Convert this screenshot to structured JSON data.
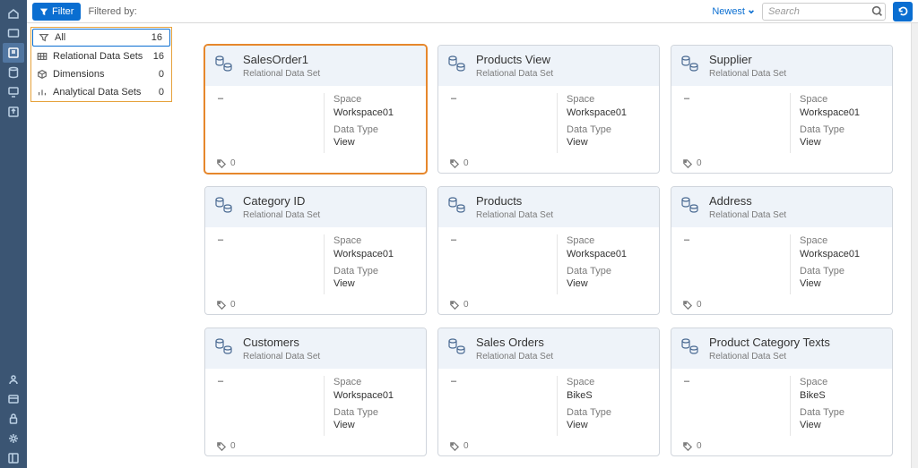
{
  "topbar": {
    "filter_label": "Filter",
    "filtered_by_label": "Filtered by:",
    "sort_label": "Newest",
    "search_placeholder": "Search"
  },
  "vnav": {
    "top": [
      {
        "name": "home-icon"
      },
      {
        "name": "folder-icon"
      },
      {
        "name": "repository-icon",
        "active": true
      },
      {
        "name": "database-icon"
      },
      {
        "name": "monitor-icon"
      },
      {
        "name": "export-icon"
      }
    ],
    "bottom": [
      {
        "name": "user-icon"
      },
      {
        "name": "settings-panel-icon"
      },
      {
        "name": "lock-icon"
      },
      {
        "name": "gear-icon"
      },
      {
        "name": "collapse-icon"
      }
    ]
  },
  "sidebar": {
    "items": [
      {
        "label": "All",
        "count": 16,
        "icon": "filter-all-icon",
        "selected": true
      },
      {
        "label": "Relational Data Sets",
        "count": 16,
        "icon": "relational-icon"
      },
      {
        "label": "Dimensions",
        "count": 0,
        "icon": "dimensions-icon"
      },
      {
        "label": "Analytical Data Sets",
        "count": 0,
        "icon": "analytical-icon"
      }
    ]
  },
  "labels": {
    "space": "Space",
    "datatype": "Data Type"
  },
  "cards": [
    {
      "title": "SalesOrder1",
      "subtitle": "Relational Data Set",
      "desc": "–",
      "space": "Workspace01",
      "datatype": "View",
      "tags": 0,
      "highlight": true
    },
    {
      "title": "Products View",
      "subtitle": "Relational Data Set",
      "desc": "–",
      "space": "Workspace01",
      "datatype": "View",
      "tags": 0
    },
    {
      "title": "Supplier",
      "subtitle": "Relational Data Set",
      "desc": "–",
      "space": "Workspace01",
      "datatype": "View",
      "tags": 0
    },
    {
      "title": "Category ID",
      "subtitle": "Relational Data Set",
      "desc": "–",
      "space": "Workspace01",
      "datatype": "View",
      "tags": 0
    },
    {
      "title": "Products",
      "subtitle": "Relational Data Set",
      "desc": "–",
      "space": "Workspace01",
      "datatype": "View",
      "tags": 0
    },
    {
      "title": "Address",
      "subtitle": "Relational Data Set",
      "desc": "–",
      "space": "Workspace01",
      "datatype": "View",
      "tags": 0
    },
    {
      "title": "Customers",
      "subtitle": "Relational Data Set",
      "desc": "–",
      "space": "Workspace01",
      "datatype": "View",
      "tags": 0
    },
    {
      "title": "Sales Orders",
      "subtitle": "Relational Data Set",
      "desc": "–",
      "space": "BikeS",
      "datatype": "View",
      "tags": 0
    },
    {
      "title": "Product Category Texts",
      "subtitle": "Relational Data Set",
      "desc": "–",
      "space": "BikeS",
      "datatype": "View",
      "tags": 0
    }
  ]
}
